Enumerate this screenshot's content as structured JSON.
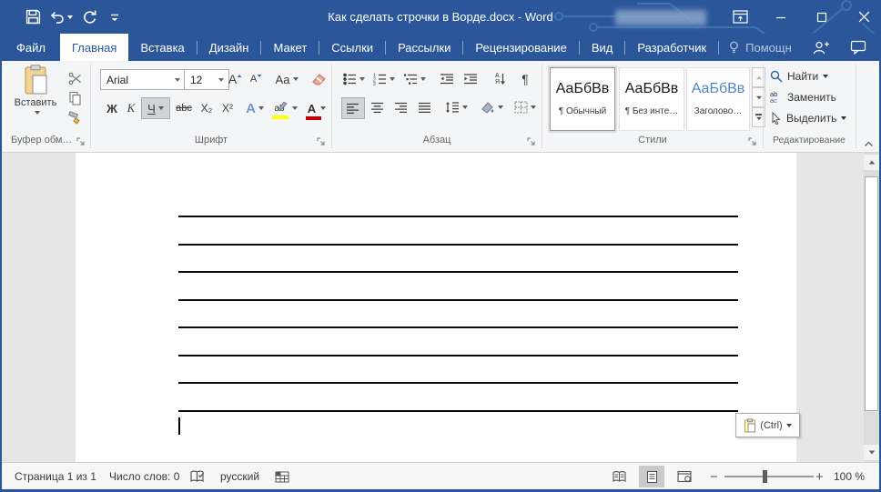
{
  "titlebar": {
    "title": "Как сделать строчки в Ворде.docx - Word"
  },
  "tabs": {
    "file": "Файл",
    "home": "Главная",
    "insert": "Вставка",
    "design": "Дизайн",
    "layout": "Макет",
    "references": "Ссылки",
    "mailings": "Рассылки",
    "review": "Рецензирование",
    "view": "Вид",
    "developer": "Разработчик",
    "tellme": "Помощн"
  },
  "ribbon": {
    "clipboard": {
      "paste": "Вставить",
      "label": "Буфер обм…"
    },
    "font": {
      "name": "Arial",
      "size": "12",
      "bold": "Ж",
      "italic": "К",
      "underline": "Ч",
      "strikethrough": "abc",
      "subscript": "Х₂",
      "superscript": "Х²",
      "grow": "А",
      "shrink": "А",
      "change_case": "Аа",
      "text_effects": "А",
      "highlight": "ab",
      "font_color": "А",
      "label": "Шрифт"
    },
    "paragraph": {
      "sort_top": "А",
      "sort_bottom": "Я",
      "pilcrow": "¶",
      "label": "Абзац"
    },
    "styles": {
      "preview": "АаБбВв",
      "s1_name": "¶ Обычный",
      "s2_name": "¶ Без инте…",
      "s3_name": "Заголово…",
      "label": "Стили"
    },
    "editing": {
      "find": "Найти",
      "replace": "Заменить",
      "select": "Выделить",
      "replace_ab": "ab",
      "replace_ac": "ac",
      "label": "Редактирование"
    }
  },
  "document": {
    "line_count": 8,
    "paste_options_label": "(Ctrl)"
  },
  "statusbar": {
    "page": "Страница 1 из 1",
    "words": "Число слов: 0",
    "language": "русский",
    "zoom": "100 %"
  },
  "colors": {
    "accent": "#2b579a",
    "highlight": "#ffff00",
    "font_color": "#c00000"
  }
}
